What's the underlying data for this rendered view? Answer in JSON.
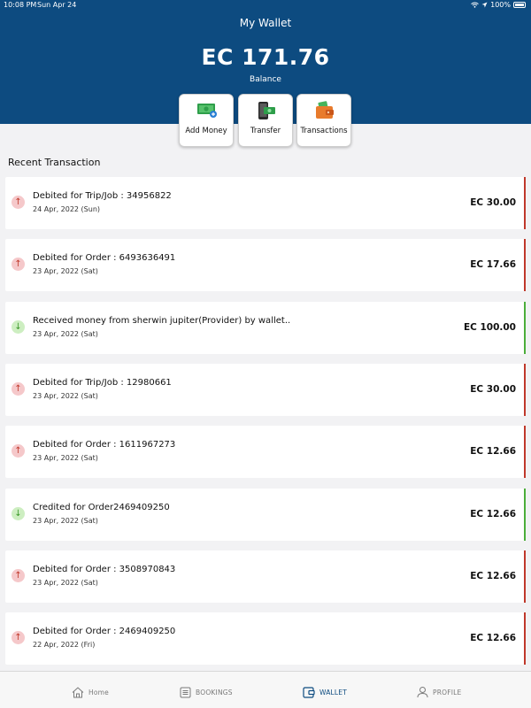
{
  "status_bar": {
    "time": "10:08 PM",
    "date": "Sun Apr 24",
    "battery": "100%"
  },
  "header": {
    "title": "My Wallet",
    "balance": "EC 171.76",
    "balance_label": "Balance"
  },
  "actions": [
    {
      "label": "Add Money",
      "icon": "add-money-icon"
    },
    {
      "label": "Transfer",
      "icon": "transfer-icon"
    },
    {
      "label": "Transactions",
      "icon": "wallet-transactions-icon"
    }
  ],
  "section_title": "Recent Transaction",
  "transactions": [
    {
      "title": "Debited for Trip/Job : 34956822",
      "date": "24 Apr, 2022 (Sun)",
      "amount": "EC 30.00",
      "type": "debit"
    },
    {
      "title": "Debited for Order : 6493636491",
      "date": "23 Apr, 2022 (Sat)",
      "amount": "EC 17.66",
      "type": "debit"
    },
    {
      "title": "Received money from sherwin jupiter(Provider)  by wallet..",
      "date": "23 Apr, 2022 (Sat)",
      "amount": "EC 100.00",
      "type": "credit"
    },
    {
      "title": "Debited for Trip/Job : 12980661",
      "date": "23 Apr, 2022 (Sat)",
      "amount": "EC 30.00",
      "type": "debit"
    },
    {
      "title": "Debited for Order : 1611967273",
      "date": "23 Apr, 2022 (Sat)",
      "amount": "EC 12.66",
      "type": "debit"
    },
    {
      "title": "Credited for Order2469409250",
      "date": "23 Apr, 2022 (Sat)",
      "amount": "EC 12.66",
      "type": "credit"
    },
    {
      "title": "Debited for Order : 3508970843",
      "date": "23 Apr, 2022 (Sat)",
      "amount": "EC 12.66",
      "type": "debit"
    },
    {
      "title": "Debited for Order : 2469409250",
      "date": "22 Apr, 2022 (Fri)",
      "amount": "EC 12.66",
      "type": "debit"
    }
  ],
  "bottom_nav": [
    {
      "label": "Home",
      "icon": "home-icon"
    },
    {
      "label": "BOOKINGS",
      "icon": "bookings-icon"
    },
    {
      "label": "WALLET",
      "icon": "wallet-icon",
      "active": true
    },
    {
      "label": "PROFILE",
      "icon": "profile-icon"
    }
  ],
  "colors": {
    "header_bg": "#0d4b80",
    "debit_edge": "#c0392b",
    "credit_edge": "#4cae3b",
    "debit_badge": "#f5c8ca",
    "credit_badge": "#cdeec1"
  }
}
